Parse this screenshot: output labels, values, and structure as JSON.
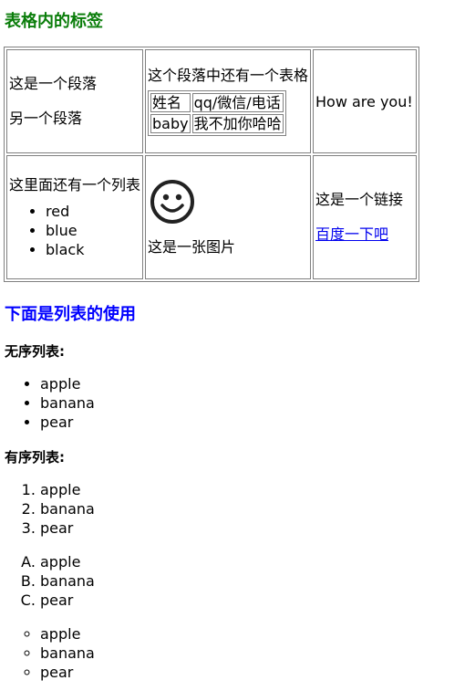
{
  "section_table": {
    "title": "表格内的标签",
    "title_color": "#0a7d0a",
    "row1": {
      "cell1": {
        "para1": "这是一个段落",
        "para2": "另一个段落"
      },
      "cell2": {
        "para": "这个段落中还有一个表格",
        "inner_table": [
          [
            "姓名",
            "qq/微信/电话"
          ],
          [
            "baby",
            "我不加你哈哈"
          ]
        ]
      },
      "cell3": {
        "text": "How are you!"
      }
    },
    "row2": {
      "cell1": {
        "para": "这里面还有一个列表",
        "items": [
          "red",
          "blue",
          "black"
        ]
      },
      "cell2": {
        "image_icon": "smiley-icon",
        "caption": "这是一张图片"
      },
      "cell3": {
        "para": "这是一个链接",
        "link": "百度一下吧"
      }
    }
  },
  "section_lists": {
    "title": "下面是列表的使用",
    "title_color": "#0000ff",
    "unordered_heading": "无序列表:",
    "unordered_items": [
      "apple",
      "banana",
      "pear"
    ],
    "ordered_heading": "有序列表:",
    "ordered_numeric": [
      "apple",
      "banana",
      "pear"
    ],
    "ordered_alpha": [
      "apple",
      "banana",
      "pear"
    ],
    "circle_items": [
      "apple",
      "banana",
      "pear"
    ]
  },
  "colors": {
    "link": "#0000ee",
    "border": "#808080"
  }
}
